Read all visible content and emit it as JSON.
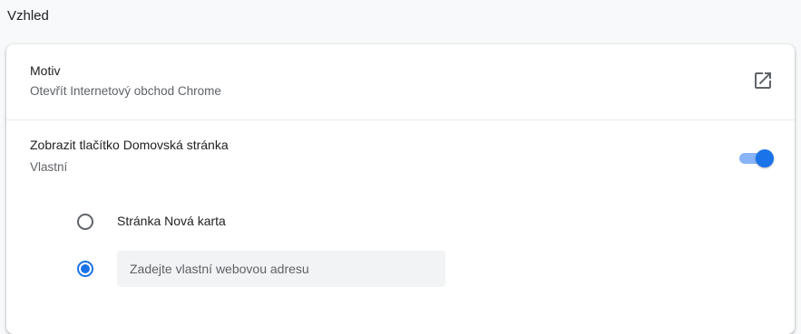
{
  "section": {
    "title": "Vzhled"
  },
  "theme_row": {
    "title": "Motiv",
    "subtitle": "Otevřít Internetový obchod Chrome",
    "icon": "open-in-new-icon"
  },
  "home_button_row": {
    "title": "Zobrazit tlačítko Domovská stránka",
    "subtitle": "Vlastní",
    "toggle_on": true
  },
  "home_options": {
    "new_tab_label": "Stránka Nová karta",
    "new_tab_selected": false,
    "custom_url_selected": true,
    "custom_url_placeholder": "Zadejte vlastní webovou adresu",
    "custom_url_value": ""
  },
  "colors": {
    "accent": "#1a73e8",
    "toggle_track": "#8ab4f8",
    "secondary_text": "#5f6368",
    "input_bg": "#f1f3f4"
  }
}
